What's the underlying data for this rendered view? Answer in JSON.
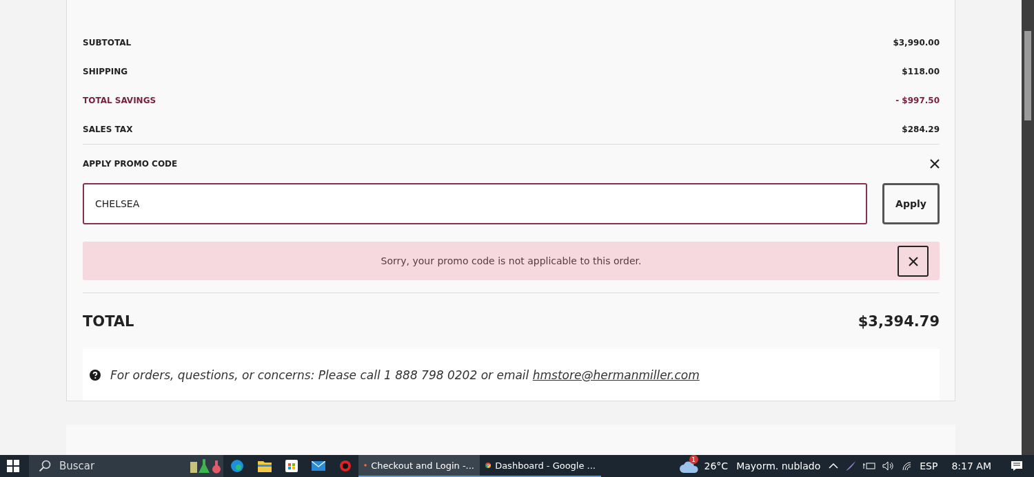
{
  "summary": [
    {
      "label": "SUBTOTAL",
      "value": "$3,990.00",
      "kind": "normal"
    },
    {
      "label": "SHIPPING",
      "value": "$118.00",
      "kind": "normal"
    },
    {
      "label": "TOTAL SAVINGS",
      "value": "- $997.50",
      "kind": "savings"
    },
    {
      "label": "SALES TAX",
      "value": "$284.29",
      "kind": "normal"
    }
  ],
  "promo": {
    "title": "APPLY PROMO CODE",
    "value": "CHELSEA",
    "button": "Apply",
    "error": "Sorry, your promo code is not applicable to this order."
  },
  "total": {
    "label": "TOTAL",
    "value": "$3,394.79"
  },
  "help": {
    "text": "For orders, questions, or concerns: Please call 1 888 798 0202 or email ",
    "link": "hmstore@hermanmiller.com"
  },
  "taskbar": {
    "search_placeholder": "Buscar",
    "windows": [
      {
        "title": "Checkout and Login -...",
        "selected": true,
        "kind": "brave"
      },
      {
        "title": "Dashboard - Google ...",
        "selected": false,
        "kind": "chrome"
      }
    ],
    "weather_badge": "1",
    "temperature": "26°C",
    "weather": "Mayorm. nublado",
    "language": "ESP",
    "time": "8:17 AM"
  }
}
